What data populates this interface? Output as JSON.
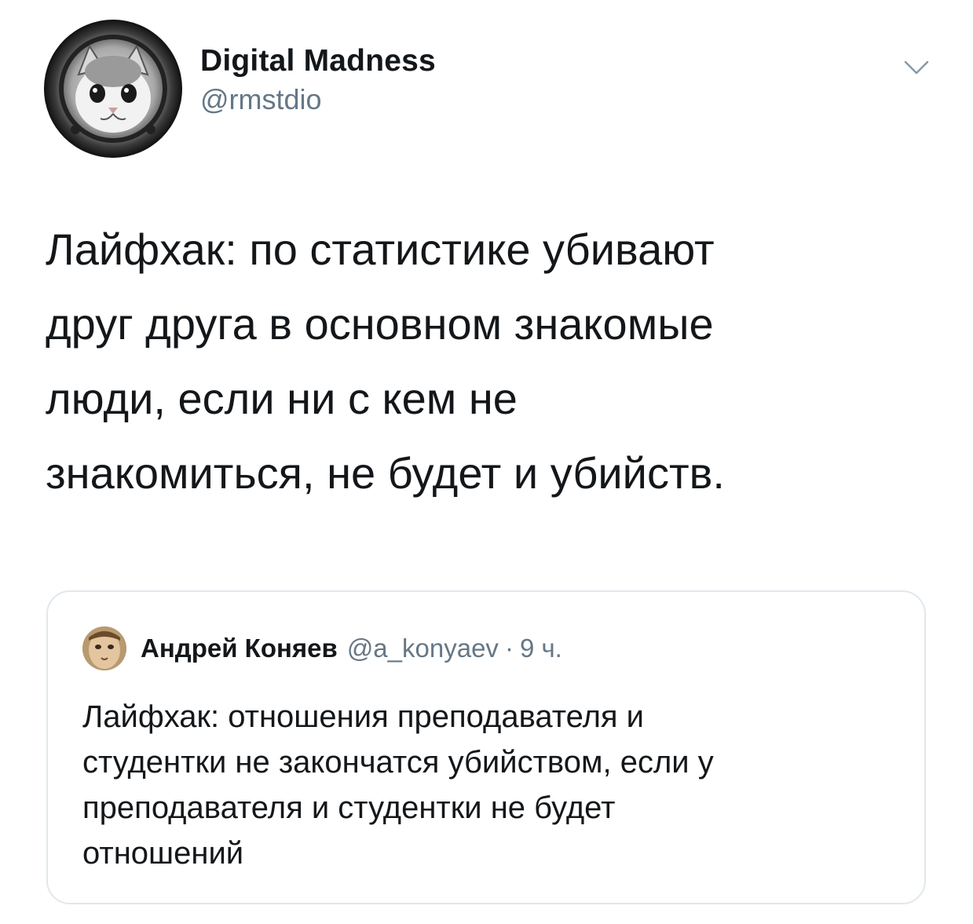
{
  "tweet": {
    "author": {
      "display_name": "Digital Madness",
      "handle": "@rmstdio",
      "avatar_icon": "cat-astronaut-avatar"
    },
    "menu_icon": "chevron-down-icon",
    "text_lines": [
      "Лайфхак: по статистике убивают",
      "друг друга в основном знакомые",
      "люди, если ни с кем не",
      "знакомиться, не будет и убийств."
    ]
  },
  "quoted_tweet": {
    "author": {
      "display_name": "Андрей Коняев",
      "handle": "@a_konyaev",
      "separator": "·",
      "time": "9 ч.",
      "avatar_icon": "user-avatar"
    },
    "text_lines": [
      "Лайфхак: отношения преподавателя и",
      "студентки не закончатся убийством, если у",
      "преподавателя и студентки не будет",
      "отношений"
    ]
  },
  "colors": {
    "text": "#14171a",
    "secondary": "#657786",
    "border": "#e1e8ed",
    "background": "#ffffff"
  }
}
